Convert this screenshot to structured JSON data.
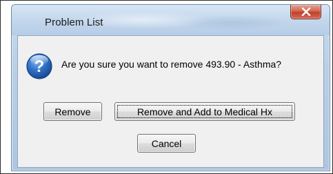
{
  "window": {
    "title": "Problem List",
    "close_glyph": "x"
  },
  "dialog": {
    "icon": "question-icon",
    "message": "Are you sure you want to remove 493.90 - Asthma?"
  },
  "buttons": {
    "remove_label": "Remove",
    "remove_add_label": "Remove and Add to Medical Hx",
    "cancel_label": "Cancel"
  },
  "colors": {
    "close_button": "#c0402a",
    "question_icon": "#2f6fc4",
    "dialog_background": "#f0f0f0"
  }
}
